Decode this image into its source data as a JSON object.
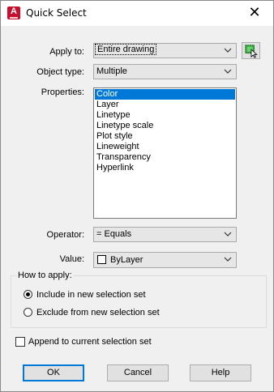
{
  "window": {
    "title": "Quick Select",
    "close_glyph": "✕"
  },
  "app_icon": {
    "letter": "A"
  },
  "apply_to": {
    "label": "Apply to:",
    "value": "Entire drawing"
  },
  "object_type": {
    "label": "Object type:",
    "value": "Multiple"
  },
  "properties": {
    "label": "Properties:",
    "items": [
      "Color",
      "Layer",
      "Linetype",
      "Linetype scale",
      "Plot style",
      "Lineweight",
      "Transparency",
      "Hyperlink"
    ],
    "selected": "Color"
  },
  "operator": {
    "label": "Operator:",
    "value": "= Equals"
  },
  "value": {
    "label": "Value:",
    "value": "ByLayer"
  },
  "how_to_apply": {
    "label": "How to apply:",
    "include": "Include in new selection set",
    "exclude": "Exclude from new selection set",
    "selected": "include"
  },
  "append": {
    "label": "Append to current selection set",
    "checked": false
  },
  "buttons": {
    "ok": "OK",
    "cancel": "Cancel",
    "help": "Help"
  },
  "colors": {
    "selection": "#0078d7",
    "app_icon": "#c8102e"
  }
}
